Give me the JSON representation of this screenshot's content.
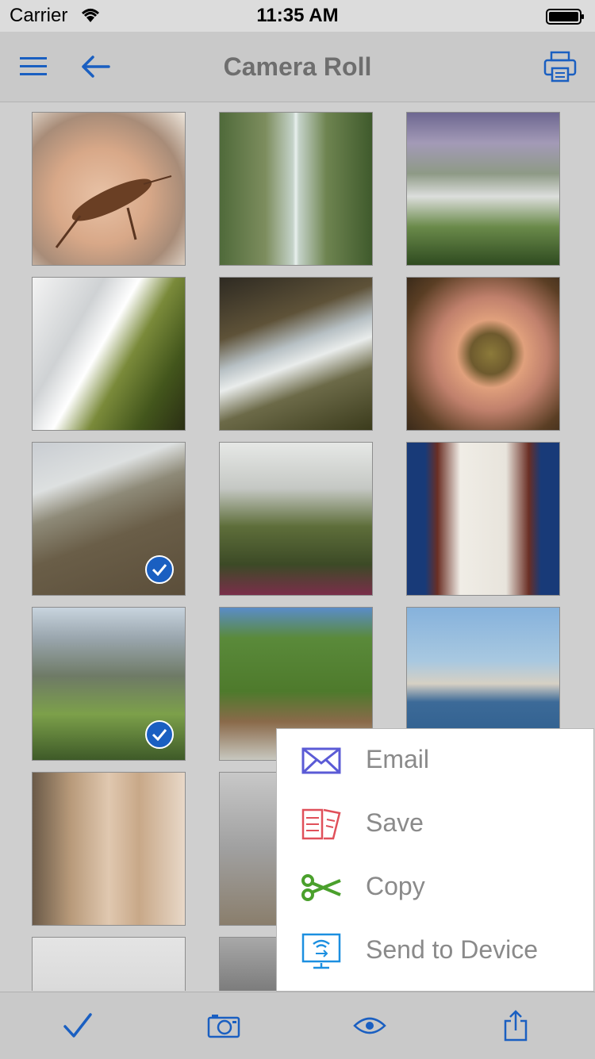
{
  "status_bar": {
    "carrier": "Carrier",
    "time": "11:35 AM"
  },
  "nav": {
    "title": "Camera Roll"
  },
  "colors": {
    "accent": "#1a5fc1",
    "menu_text": "#8a8a8a",
    "email_icon": "#5b5bd6",
    "save_icon": "#e0505a",
    "copy_icon": "#4aa02c",
    "send_icon": "#1c8fe0"
  },
  "photos": [
    {
      "subject": "grasshopper in hand",
      "selected": false
    },
    {
      "subject": "tall waterfall in forest",
      "selected": false
    },
    {
      "subject": "waterfall over cliff",
      "selected": false
    },
    {
      "subject": "water rushing over mossy rocks",
      "selected": false
    },
    {
      "subject": "waterfall with rocky ledge",
      "selected": false
    },
    {
      "subject": "frog in hands",
      "selected": false
    },
    {
      "subject": "dog on beach",
      "selected": true
    },
    {
      "subject": "flowers in grass",
      "selected": false
    },
    {
      "subject": "clock tower",
      "selected": false
    },
    {
      "subject": "alpine valley",
      "selected": true
    },
    {
      "subject": "mountain village",
      "selected": false
    },
    {
      "subject": "lakeside castle",
      "selected": false
    },
    {
      "subject": "canal town",
      "selected": false
    },
    {
      "subject": "grey building",
      "selected": false
    },
    {
      "subject": "grand hotel",
      "selected": false
    },
    {
      "subject": "dark photo",
      "selected": false
    }
  ],
  "menu": {
    "items": [
      {
        "label": "Email",
        "icon": "envelope-icon"
      },
      {
        "label": "Save",
        "icon": "document-icon"
      },
      {
        "label": "Copy",
        "icon": "scissors-icon"
      },
      {
        "label": "Send to Device",
        "icon": "wifi-monitor-icon"
      }
    ]
  },
  "toolbar": {
    "icons": [
      "checkmark-icon",
      "camera-icon",
      "eye-icon",
      "share-icon"
    ]
  }
}
